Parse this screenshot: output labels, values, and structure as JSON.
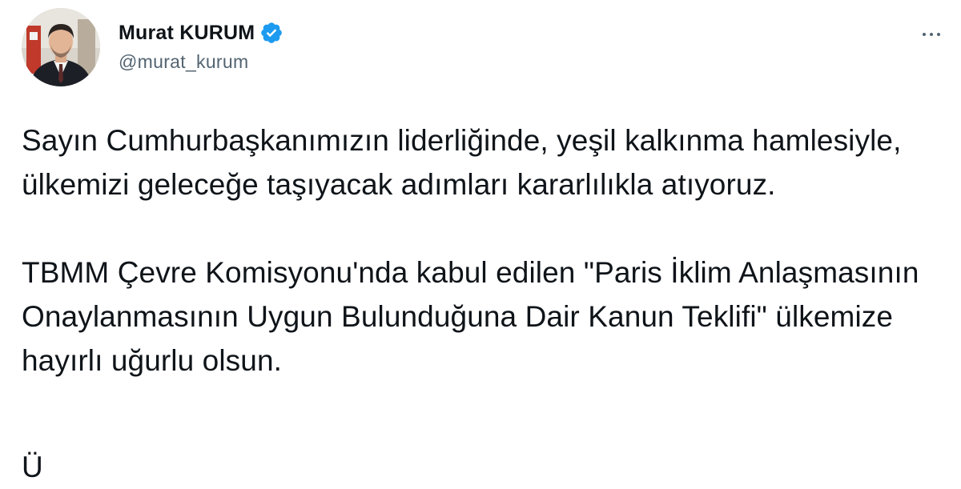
{
  "user": {
    "display_name": "Murat KURUM",
    "handle": "@murat_kurum",
    "verified": true,
    "avatar_icon": "profile-photo"
  },
  "menu_icon": "more-horizontal-icon",
  "tweet": {
    "paragraphs": [
      "Sayın Cumhurbaşkanımızın liderliğinde, yeşil kalkınma hamlesiyle, ülkemizi geleceğe taşıyacak adımları kararlılıkla atıyoruz.",
      "TBMM Çevre Komisyonu'nda kabul edilen \"Paris İklim Anlaşmasının Onaylanmasının Uygun Bulunduğuna Dair Kanun Teklifi\" ülkemize hayırlı uğurlu olsun."
    ],
    "cut_off_text": "Ü"
  },
  "colors": {
    "text": "#0f1419",
    "secondary": "#536471",
    "verified_badge": "#1d9bf0"
  }
}
